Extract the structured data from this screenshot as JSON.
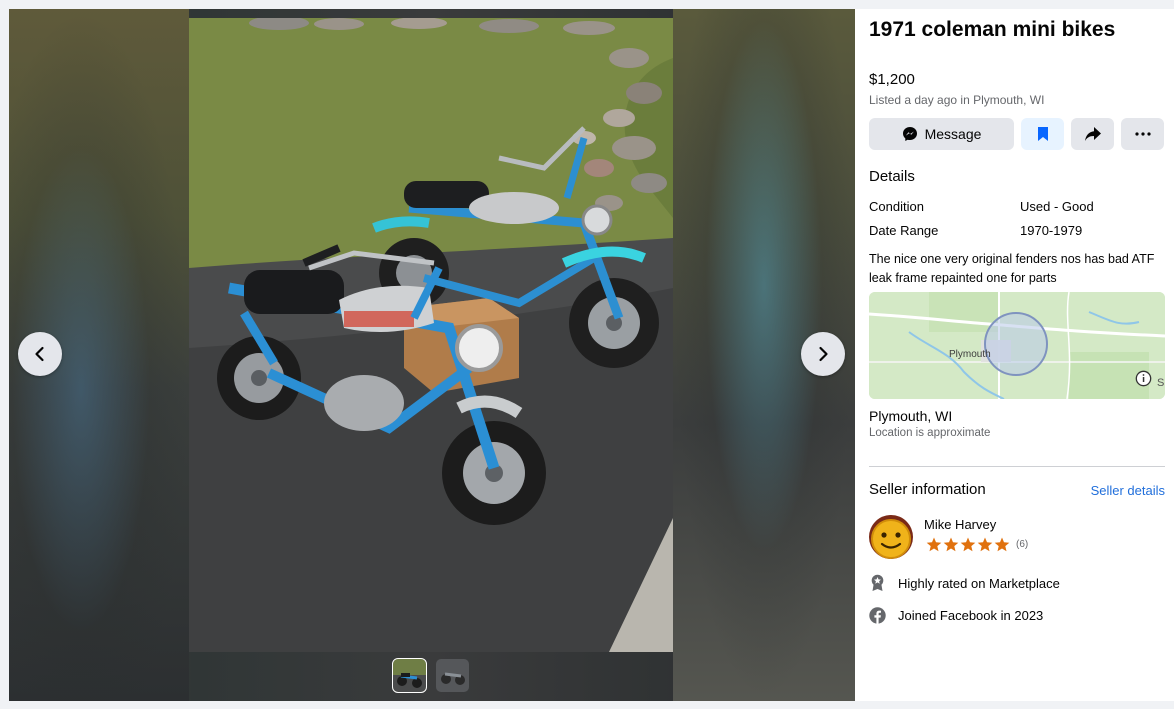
{
  "listing": {
    "title": "1971 coleman mini bikes",
    "price": "$1,200",
    "listed": "Listed a day ago in Plymouth, WI"
  },
  "actions": {
    "message_label": "Message"
  },
  "details": {
    "heading": "Details",
    "rows": [
      {
        "key": "Condition",
        "value": "Used - Good"
      },
      {
        "key": "Date Range",
        "value": "1970-1979"
      }
    ],
    "description": "The nice one very original fenders nos has bad ATF leak frame repainted one for parts"
  },
  "map": {
    "city_label": "Plymouth",
    "edge_letter": "S"
  },
  "location": {
    "name": "Plymouth, WI",
    "note": "Location is approximate"
  },
  "seller": {
    "heading": "Seller information",
    "details_link": "Seller details",
    "name": "Mike Harvey",
    "rating_stars": 5,
    "rating_count": "(6)",
    "badges": [
      {
        "icon": "award-ribbon-icon",
        "text": "Highly rated on Marketplace"
      },
      {
        "icon": "facebook-icon",
        "text": "Joined Facebook in 2023"
      }
    ]
  },
  "gallery": {
    "photo_count": 2,
    "active_index": 0
  },
  "colors": {
    "star": "#e0710e",
    "link": "#216fdb",
    "save_bg": "#e7f3ff",
    "save_icon": "#0866ff"
  }
}
